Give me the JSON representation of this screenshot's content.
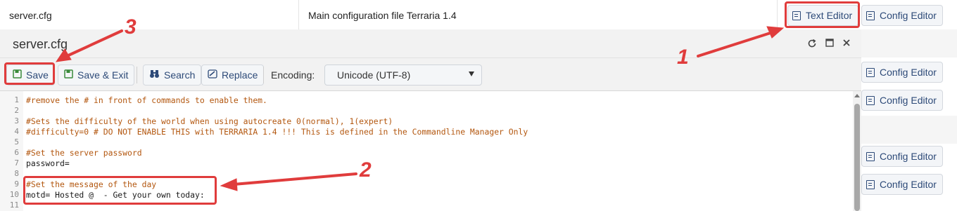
{
  "table": {
    "row1": {
      "file": "server.cfg",
      "description": "Main configuration file Terraria 1.4"
    },
    "text_editor_label": "Text Editor",
    "config_editor_label": "Config Editor"
  },
  "dialog": {
    "title": "server.cfg",
    "toolbar": {
      "save": "Save",
      "save_exit": "Save & Exit",
      "search": "Search",
      "replace": "Replace",
      "encoding_label": "Encoding:",
      "encoding_value": "Unicode (UTF-8)"
    }
  },
  "editor": {
    "lines": [
      {
        "n": "1",
        "text": "#remove the # in front of commands to enable them.",
        "type": "comment"
      },
      {
        "n": "2",
        "text": "",
        "type": "plain"
      },
      {
        "n": "3",
        "text": "#Sets the difficulty of the world when using autocreate 0(normal), 1(expert)",
        "type": "comment"
      },
      {
        "n": "4",
        "text": "#difficulty=0 # DO NOT ENABLE THIS with TERRARIA 1.4 !!! This is defined in the Commandline Manager Only",
        "type": "comment"
      },
      {
        "n": "5",
        "text": "",
        "type": "plain"
      },
      {
        "n": "6",
        "text": "#Set the server password",
        "type": "comment"
      },
      {
        "n": "7",
        "text": "password=",
        "type": "plain"
      },
      {
        "n": "8",
        "text": "",
        "type": "plain"
      },
      {
        "n": "9",
        "text": "#Set the message of the day",
        "type": "comment"
      },
      {
        "n": "10",
        "text": "motd= Hosted @  - Get your own today:",
        "type": "plain"
      },
      {
        "n": "11",
        "text": "",
        "type": "plain"
      }
    ]
  },
  "annotations": {
    "one": "1",
    "two": "2",
    "three": "3"
  },
  "colors": {
    "accent": "#2d4a78",
    "annotation": "#e03c3c",
    "comment": "#b3570f"
  }
}
